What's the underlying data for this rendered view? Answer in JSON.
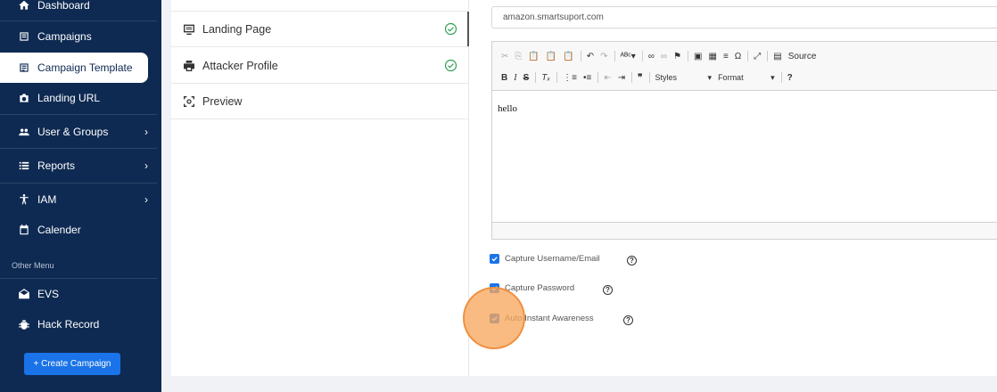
{
  "sidebar": {
    "items": [
      {
        "label": "Dashboard",
        "icon": "home-icon"
      },
      {
        "label": "Campaigns",
        "icon": "campaigns-icon"
      },
      {
        "label": "Campaign Template",
        "icon": "template-icon"
      },
      {
        "label": "Landing URL",
        "icon": "camera-icon"
      },
      {
        "label": "User & Groups",
        "icon": "users-icon"
      },
      {
        "label": "Reports",
        "icon": "list-icon"
      },
      {
        "label": "IAM",
        "icon": "person-icon"
      },
      {
        "label": "Calender",
        "icon": "calendar-icon"
      }
    ],
    "other_menu_label": "Other Menu",
    "other_items": [
      {
        "label": "EVS",
        "icon": "mail-open-icon"
      },
      {
        "label": "Hack Record",
        "icon": "bug-icon"
      }
    ],
    "create_button": "+ Create Campaign",
    "chevron": "›"
  },
  "steps": [
    {
      "label": "Landing Page"
    },
    {
      "label": "Attacker Profile"
    },
    {
      "label": "Preview"
    }
  ],
  "editor": {
    "url_value": "amazon.smartsuport.com",
    "source_label": "Source",
    "styles_label": "Styles",
    "format_label": "Format",
    "content": "hello"
  },
  "options": [
    {
      "label": "Capture Username/Email",
      "checked": true
    },
    {
      "label": "Capture Password",
      "checked": true
    },
    {
      "label": "Auto Instant Awareness",
      "checked": true
    }
  ],
  "colors": {
    "sidebar_bg": "#0e2a52",
    "accent": "#1a73e8",
    "success": "#2e9e4f"
  }
}
